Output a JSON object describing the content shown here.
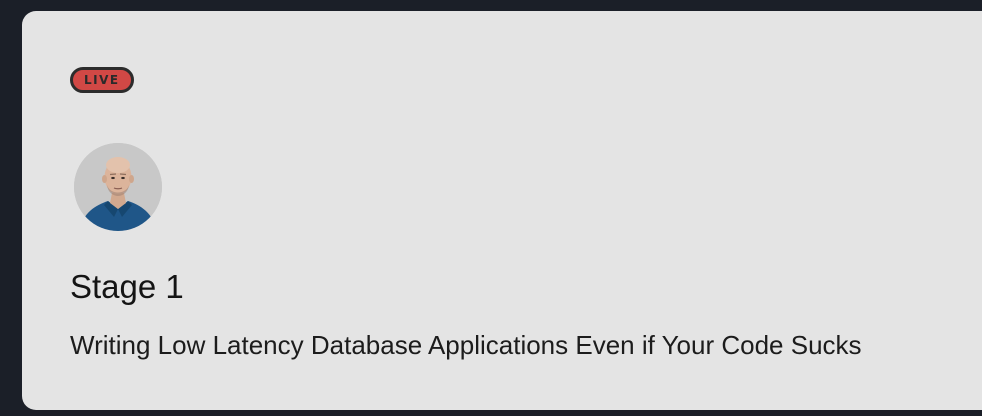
{
  "session_card": {
    "live_badge": "LIVE",
    "avatar_icon": "speaker-portrait",
    "stage_name": "Stage 1",
    "talk_title": "Writing Low Latency Database Applications Even if Your Code Sucks"
  },
  "colors": {
    "page_background": "#1b1f28",
    "card_background": "#e4e4e4",
    "live_badge_fill": "#d14845",
    "live_badge_border": "#2c2c2c",
    "text_primary": "#141414"
  }
}
